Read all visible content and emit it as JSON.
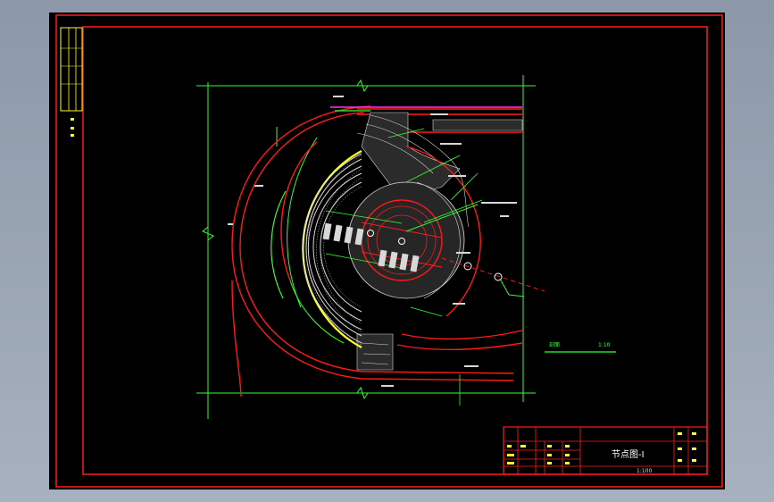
{
  "title_block": {
    "title": "节点图-Ⅰ",
    "scale": "1:100"
  },
  "drawing": {
    "detail_note": "剖面",
    "detail_scale": "1:10",
    "colors": {
      "background": "#000000",
      "frame": "#ff1a1a",
      "dimension": "#33ff33",
      "paving": "#d8d8d8",
      "label": "#ffff33",
      "accent": "#ff33ff",
      "canvas_outer": "#9aa5b4"
    }
  }
}
